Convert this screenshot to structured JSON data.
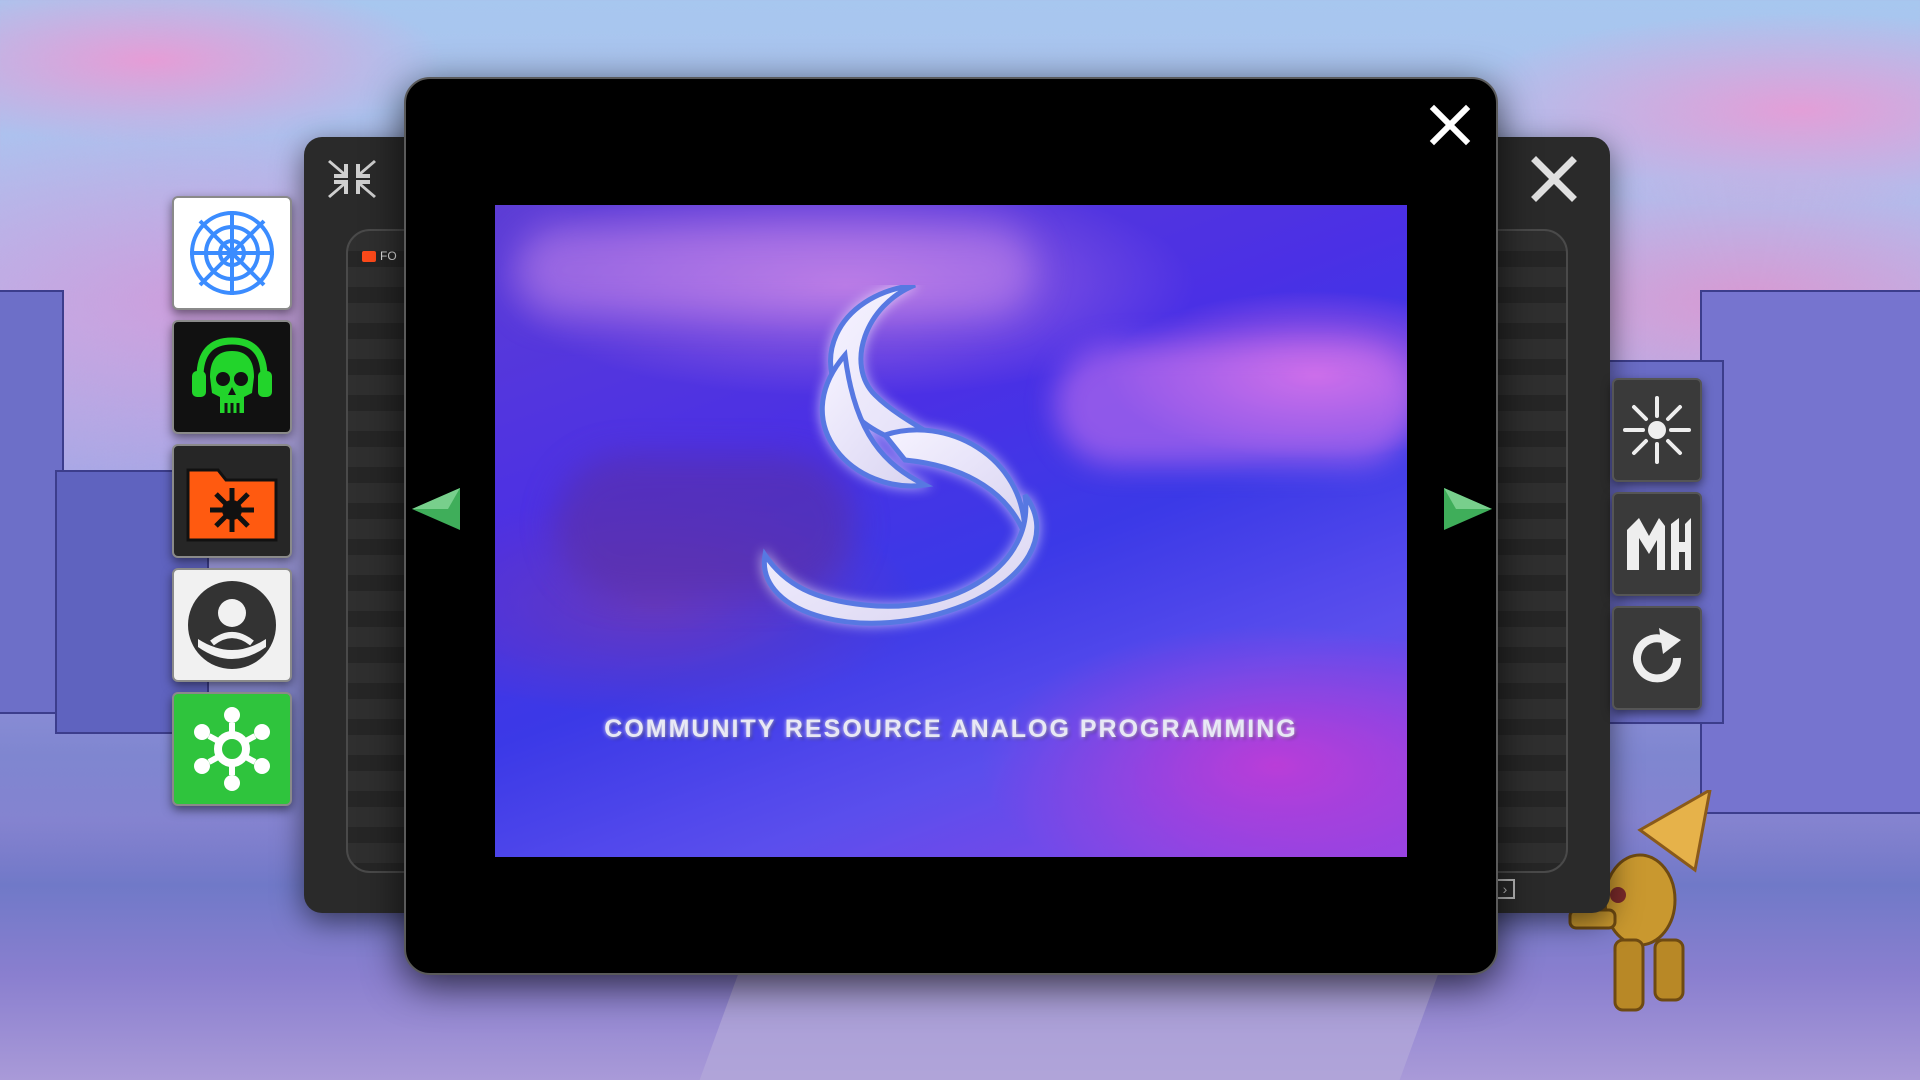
{
  "background": {
    "sky_color": "#a7c7ef",
    "ground_color": "#8a7fcf"
  },
  "left_window": {
    "minimize_icon": "collapse-arrows-icon",
    "folder_tab_label": "FO"
  },
  "right_window": {
    "close_icon": "close-icon",
    "corner_icon": "resize-corner-icon"
  },
  "left_dock": [
    {
      "name": "web",
      "icon": "spider-web-icon",
      "bg": "#ffffff",
      "fg": "#3b8cff"
    },
    {
      "name": "skull",
      "icon": "skull-headphones-icon",
      "bg": "#111111",
      "fg": "#22d42b"
    },
    {
      "name": "folder",
      "icon": "biohazard-folder-icon",
      "bg": "#262626",
      "fg": "#ff5a10"
    },
    {
      "name": "user",
      "icon": "user-circle-icon",
      "bg": "#f1f1f1",
      "fg": "#333333"
    },
    {
      "name": "settings",
      "icon": "snowflake-gear-icon",
      "bg": "#2fc43d",
      "fg": "#ffffff"
    }
  ],
  "right_dock": [
    {
      "name": "sparkle",
      "icon": "sunburst-icon"
    },
    {
      "name": "logo",
      "icon": "mh-logo-icon"
    },
    {
      "name": "refresh",
      "icon": "refresh-icon"
    }
  ],
  "viewer": {
    "close_icon": "close-icon",
    "prev_icon": "arrow-left-icon",
    "next_icon": "arrow-right-icon",
    "arrow_color": "#3fae5a",
    "caption": "COMMUNITY RESOURCE ANALOG PROGRAMMING",
    "logo_icon": "swirl-s-logo-icon"
  }
}
